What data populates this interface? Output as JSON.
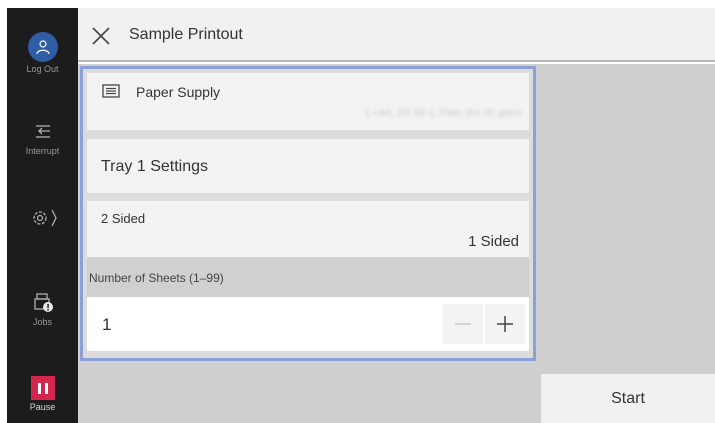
{
  "sidebar": {
    "logout_label": "Log Out",
    "interrupt_label": "Interrupt",
    "jobs_label": "Jobs",
    "pause_label": "Pause"
  },
  "header": {
    "title": "Sample Printout"
  },
  "settings": {
    "paper_supply_label": "Paper Supply",
    "paper_supply_value": "1 ▪ A4, JIS B5 ▯, Plain (64–81 gsm)",
    "tray_settings_label": "Tray 1 Settings",
    "two_sided_label": "2 Sided",
    "two_sided_value": "1 Sided",
    "sheets_label": "Number of Sheets (1–99)",
    "sheets_value": "1"
  },
  "actions": {
    "start_label": "Start"
  },
  "colors": {
    "sidebar_bg": "#1c1c1c",
    "logout_accent": "#2f5da6",
    "pause_accent": "#d6254c",
    "highlight_border": "#8d9fd8"
  },
  "icons": {
    "close": "close-icon",
    "logout": "user-icon",
    "interrupt": "interrupt-icon",
    "settings": "gear-icon",
    "jobs": "printer-icon",
    "pause": "pause-icon",
    "paper": "list-icon",
    "minus": "minus-icon",
    "plus": "plus-icon"
  }
}
